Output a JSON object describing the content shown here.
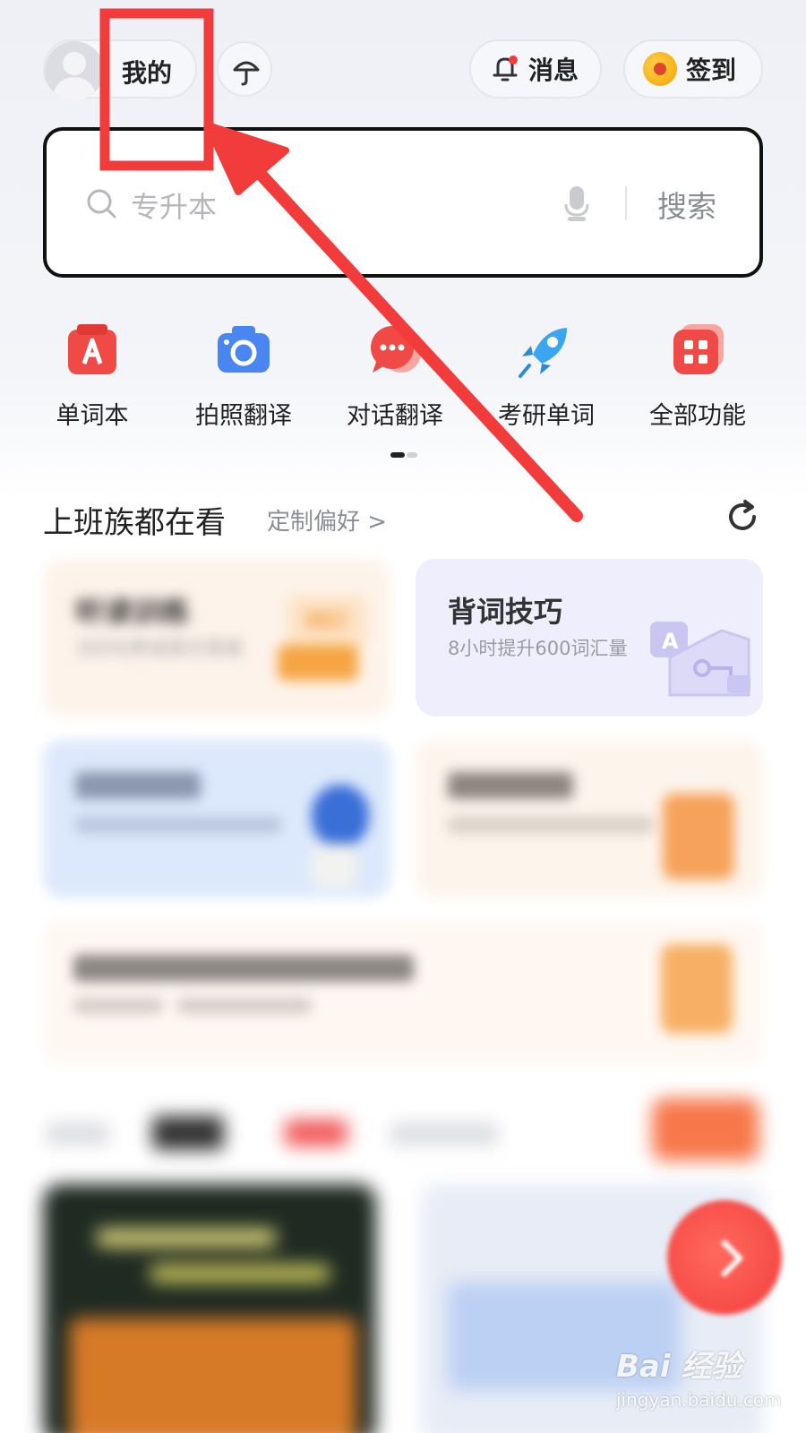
{
  "topbar": {
    "profile_label": "我的",
    "messages_label": "消息",
    "checkin_label": "签到"
  },
  "search": {
    "placeholder": "专升本",
    "button_label": "搜索"
  },
  "features": [
    {
      "label": "单词本",
      "icon": "vocabulary-book-icon"
    },
    {
      "label": "拍照翻译",
      "icon": "camera-icon"
    },
    {
      "label": "对话翻译",
      "icon": "chat-bubble-icon"
    },
    {
      "label": "考研单词",
      "icon": "rocket-icon"
    },
    {
      "label": "全部功能",
      "icon": "grid-apps-icon"
    }
  ],
  "pager": {
    "pages": 2,
    "current": 1
  },
  "section": {
    "title": "上班族都在看",
    "link": "定制偏好 >"
  },
  "cards": [
    {
      "title": "听读训练",
      "subtitle": "300句养成英文思维",
      "badge": "Hi!"
    },
    {
      "title": "背词技巧",
      "subtitle": "8小时提升600词汇量",
      "badge": "A"
    }
  ],
  "watermark": {
    "logo": "Bai 经验",
    "url": "jingyan.baidu.com"
  },
  "annotation": {
    "color": "#f23b3b"
  },
  "colors": {
    "accent_red": "#f23b3b",
    "brand_blue": "#3b7bf0"
  }
}
